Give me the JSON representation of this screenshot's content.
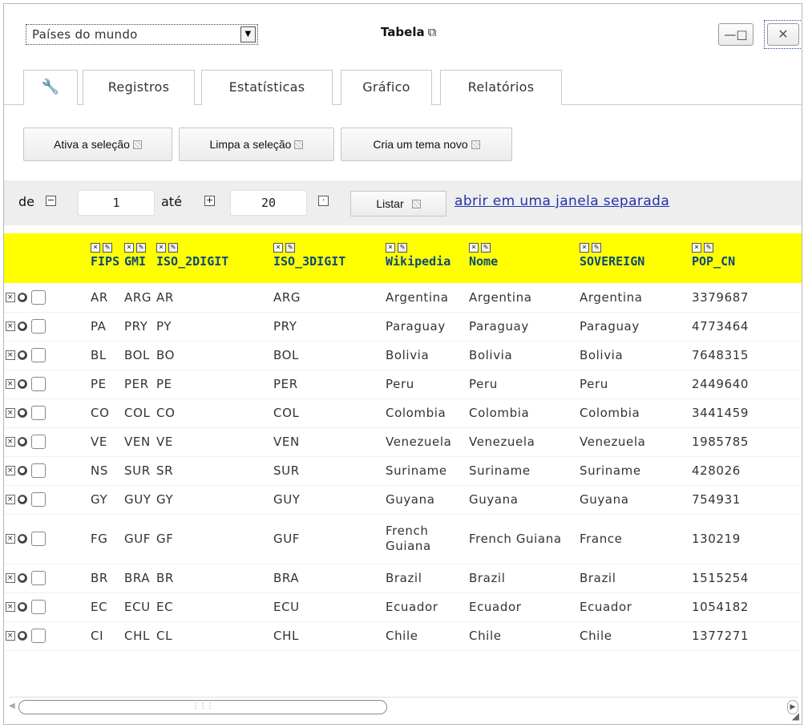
{
  "window": {
    "theme_select": "Países do mundo",
    "title": "Tabela",
    "maximize_label": "—□",
    "close_label": "✕"
  },
  "tabs": [
    "Registros",
    "Estatísticas",
    "Gráfico",
    "Relatórios"
  ],
  "actions": {
    "activate": "Ativa a seleção",
    "clear": "Limpa a seleção",
    "new_theme": "Cria um tema novo"
  },
  "pager": {
    "from_label": "de",
    "from_value": "1",
    "to_label": "até",
    "to_value": "20",
    "list_label": "Listar",
    "open_link": "abrir em uma janela separada"
  },
  "table": {
    "columns": [
      "FIPS",
      "GMI",
      "ISO_2DIGIT",
      "ISO_3DIGIT",
      "Wikipedia",
      "Nome",
      "SOVEREIGN",
      "POP_CN"
    ],
    "rows": [
      [
        "AR",
        "ARG",
        "AR",
        "ARG",
        "Argentina",
        "Argentina",
        "Argentina",
        "3379687"
      ],
      [
        "PA",
        "PRY",
        "PY",
        "PRY",
        "Paraguay",
        "Paraguay",
        "Paraguay",
        "4773464"
      ],
      [
        "BL",
        "BOL",
        "BO",
        "BOL",
        "Bolivia",
        "Bolivia",
        "Bolivia",
        "7648315"
      ],
      [
        "PE",
        "PER",
        "PE",
        "PER",
        "Peru",
        "Peru",
        "Peru",
        "2449640"
      ],
      [
        "CO",
        "COL",
        "CO",
        "COL",
        "Colombia",
        "Colombia",
        "Colombia",
        "3441459"
      ],
      [
        "VE",
        "VEN",
        "VE",
        "VEN",
        "Venezuela",
        "Venezuela",
        "Venezuela",
        "1985785"
      ],
      [
        "NS",
        "SUR",
        "SR",
        "SUR",
        "Suriname",
        "Suriname",
        "Suriname",
        "428026"
      ],
      [
        "GY",
        "GUY",
        "GY",
        "GUY",
        "Guyana",
        "Guyana",
        "Guyana",
        "754931"
      ],
      [
        "FG",
        "GUF",
        "GF",
        "GUF",
        "French Guiana",
        "French Guiana",
        "France",
        "130219"
      ],
      [
        "BR",
        "BRA",
        "BR",
        "BRA",
        "Brazil",
        "Brazil",
        "Brazil",
        "1515254"
      ],
      [
        "EC",
        "ECU",
        "EC",
        "ECU",
        "Ecuador",
        "Ecuador",
        "Ecuador",
        "1054182"
      ],
      [
        "CI",
        "CHL",
        "CL",
        "CHL",
        "Chile",
        "Chile",
        "Chile",
        "1377271"
      ]
    ]
  },
  "icons": {
    "tab_tools": "wrench-icon",
    "title_external": "external-window-icon",
    "row_delete": "delete-icon",
    "row_zoom": "zoom-icon",
    "col_remove": "remove-column-icon",
    "col_edit": "edit-column-icon"
  },
  "colors": {
    "header_bg": "#ffff00",
    "header_text": "#0b4a7a",
    "link": "#2233aa",
    "pager_bg": "#eeeeee"
  }
}
